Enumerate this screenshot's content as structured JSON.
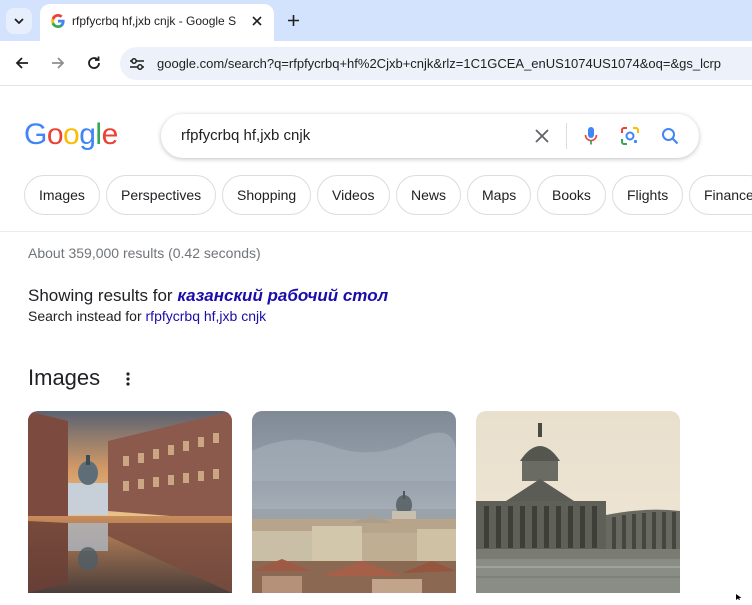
{
  "browser": {
    "tab": {
      "title": "rfpfycrbq hf,jxb cnjk - Google S"
    },
    "omnibox": {
      "url": "google.com/search?q=rfpfycrbq+hf%2Cjxb+cnjk&rlz=1C1GCEA_enUS1074US1074&oq=&gs_lcrp"
    }
  },
  "search": {
    "logo_letters": [
      {
        "char": "G",
        "color": "#4285F4"
      },
      {
        "char": "o",
        "color": "#EA4335"
      },
      {
        "char": "o",
        "color": "#FBBC05"
      },
      {
        "char": "g",
        "color": "#4285F4"
      },
      {
        "char": "l",
        "color": "#34A853"
      },
      {
        "char": "e",
        "color": "#EA4335"
      }
    ],
    "query": "rfpfycrbq hf,jxb cnjk"
  },
  "chips": [
    "Images",
    "Perspectives",
    "Shopping",
    "Videos",
    "News",
    "Maps",
    "Books",
    "Flights",
    "Finance"
  ],
  "results": {
    "stats": "About 359,000 results (0.42 seconds)",
    "showing_prefix": "Showing results for",
    "corrected_query": "казанский рабочий стол",
    "instead_prefix": "Search instead for",
    "original_query": "rfpfycrbq hf,jxb cnjk"
  },
  "images_section": {
    "heading": "Images",
    "thumbnails": [
      "street-reflection-thumbnail",
      "city-skyline-thumbnail",
      "kazan-cathedral-thumbnail"
    ]
  },
  "colors": {
    "tabbar": "#d3e3fd",
    "omnibox": "#edf2fa",
    "link": "#1a0dab",
    "accent_blue": "#1a73e8"
  }
}
